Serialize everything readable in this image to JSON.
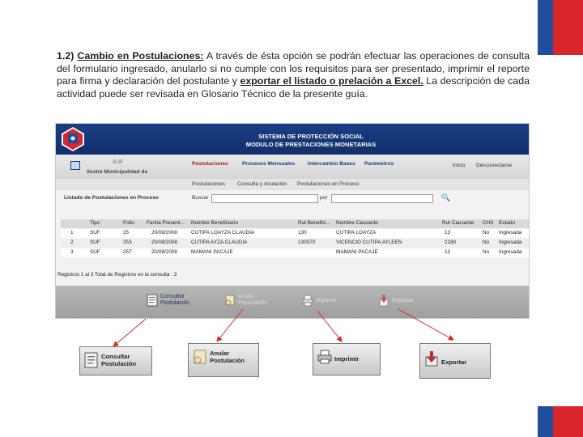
{
  "paragraph": {
    "number": "1.2)",
    "title": "Cambio en Postulaciones:",
    "text1": " A través de ésta opción se podrán efectuar las operaciones de consulta del formulario ingresado, anularlo si no cumple con los requisitos para ser presentado, imprimir el reporte para firma y declaración del postulante y ",
    "highlight": "exportar el listado o prelación a Excel.",
    "text2": " La descripción de cada actividad puede ser revisada en Glosario Técnico de la presente guía."
  },
  "app": {
    "banner_line1": "SISTEMA DE PROTECCIÓN SOCIAL",
    "banner_line2": "MODULO DE PRESTACIONES MONETARIAS",
    "org_code": "SUF",
    "org_name": "Ilustre Municipalidad de",
    "menu": [
      "Postulaciones",
      "Procesos Mensuales",
      "Intercambio Bases",
      "Parámetros"
    ],
    "top_links": [
      "Inicio",
      "Desconectarse"
    ],
    "submenu": [
      "Postulaciones",
      "Consulta y Anulación",
      "Postulaciones en Proceso"
    ],
    "list_title": "Listado de Postulaciones en Proceso",
    "search_label": "Buscar",
    "por_label": "por",
    "columns": [
      "Tipo",
      "Folio",
      "Fecha Present...",
      "Nombre Beneficiario",
      "Rut Benefici...",
      "Nombre Causante",
      "Rut Causante",
      "CHS",
      "Estado"
    ],
    "rows": [
      {
        "n": "1",
        "tipo": "SUF",
        "folio": "25",
        "fecha": "20/08/2008",
        "nombre": "CUTIPA LOAYZA CLAUDIA",
        "rut": "130",
        "causante": "CUTIPA LOAYZA",
        "rutc": "13",
        "chs": "No",
        "estado": "Ingresada"
      },
      {
        "n": "2",
        "tipo": "SUF",
        "folio": "253",
        "fecha": "20/08/2008",
        "nombre": "CUTIPA AYZA CLAUDIA",
        "rut": "130070",
        "causante": "VICENCIO CUTIPA AYLEEN",
        "rutc": "2180",
        "chs": "No",
        "estado": "Ingresada"
      },
      {
        "n": "3",
        "tipo": "SUF",
        "folio": "257",
        "fecha": "20/08/2008",
        "nombre": "MAMANI PACAJE",
        "rut": "",
        "causante": "MAMANI PACAJE",
        "rutc": "13",
        "chs": "No",
        "estado": "Ingresada"
      }
    ],
    "status": "Registros 1 al 3   Total de Registros en la consulta : 3",
    "actions": {
      "consultar": "Consultar Postulación",
      "anular": "Anular Postulación",
      "imprimir": "Imprimir",
      "exportar": "Exportar"
    }
  },
  "zooms": {
    "consultar": "Consultar Postulación",
    "anular": "Anular Postulación",
    "imprimir": "Imprimir",
    "exportar": "Exportar"
  },
  "colors": {
    "blue": "#1f4f9c",
    "red": "#d8262c",
    "banner": "#1b3e84",
    "arrow": "#d9262c"
  }
}
